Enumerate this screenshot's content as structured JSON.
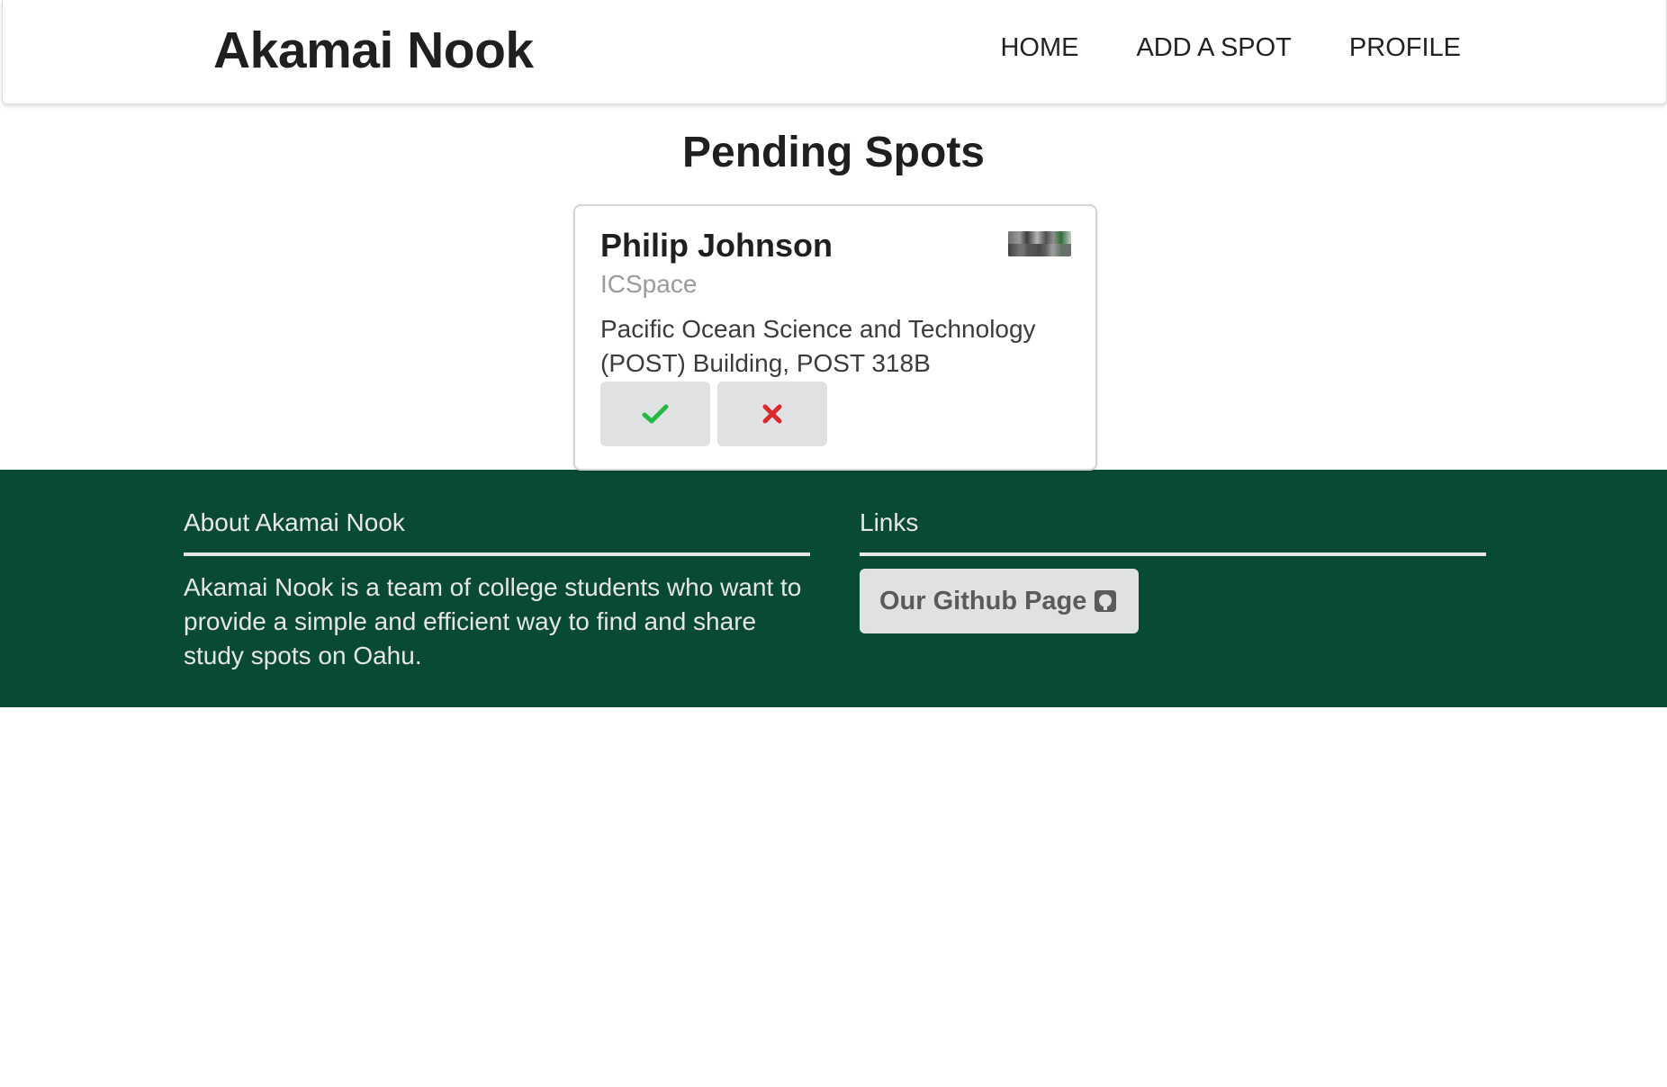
{
  "header": {
    "brand": "Akamai Nook",
    "nav": [
      {
        "label": "HOME"
      },
      {
        "label": "ADD A SPOT"
      },
      {
        "label": "PROFILE"
      }
    ]
  },
  "main": {
    "title": "Pending Spots",
    "card": {
      "name": "Philip Johnson",
      "meta": "ICSpace",
      "description": "Pacific Ocean Science and Technology (POST) Building, POST 318B",
      "approve_icon": "check-icon",
      "reject_icon": "close-icon",
      "approve_color": "#21ba45",
      "reject_color": "#db2828"
    }
  },
  "footer": {
    "about_heading": "About Akamai Nook",
    "about_text": "Akamai Nook is a team of college students who want to provide a simple and efficient way to find and share study spots on Oahu.",
    "links_heading": "Links",
    "github_label": "Our Github Page",
    "github_icon": "github-square-icon",
    "background_color": "#094a33"
  }
}
